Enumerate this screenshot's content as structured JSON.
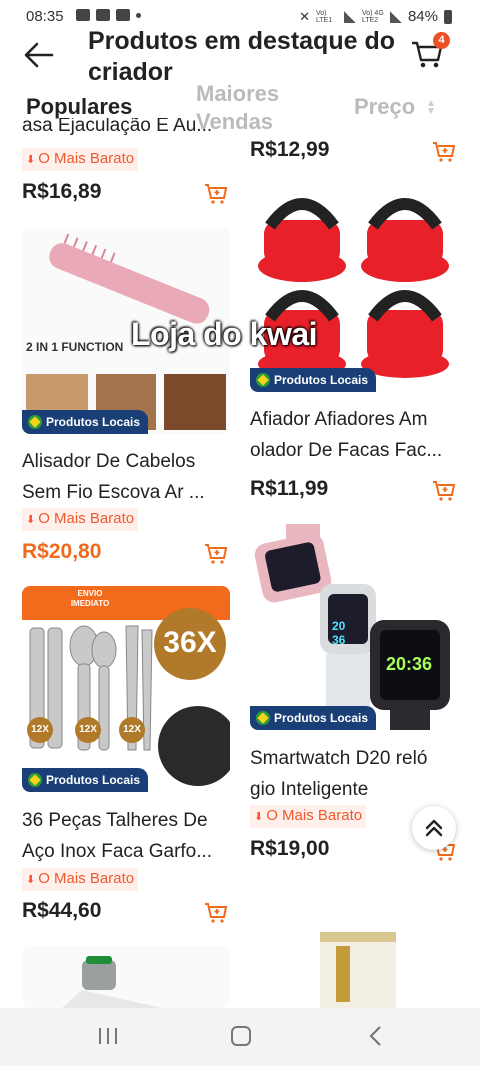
{
  "status_bar": {
    "time": "08:35",
    "battery": "84%",
    "net1": "Vo) LTE1",
    "net2": "Vo) 4G LTE2"
  },
  "header": {
    "title": "Produtos em destaque do criador",
    "cart_count": "4"
  },
  "tabs": {
    "popular": "Populares",
    "best_sellers": "Maiores Vendas",
    "price": "Preço"
  },
  "overlay": {
    "watermark": "Loja do kwai"
  },
  "labels": {
    "cheapest": "O Mais Barato",
    "local": "Produtos Locais"
  },
  "products": {
    "p0": {
      "name": "asa Ejaculação E Au...",
      "cheapest": true,
      "price": "R$16,89"
    },
    "p1": {
      "price": "R$12,99"
    },
    "p2": {
      "name1": "Alisador De Cabelos",
      "name2": "Sem Fio Escova Ar ...",
      "price": "R$20,80",
      "image_text": "2 IN 1 FUNCTION"
    },
    "p3": {
      "name1": "Afiador Afiadores Am",
      "name2": "olador De Facas Fac...",
      "price": "R$11,99"
    },
    "p4": {
      "name1": "36 Peças Talheres De",
      "name2": "Aço Inox Faca Garfo...",
      "price": "R$44,60",
      "image_text_big": "36X",
      "image_text_tag": "ENVIO IMEDIATO",
      "image_text_12": "12X"
    },
    "p5": {
      "name1": "Smartwatch D20 reló",
      "name2": "gio Inteligente",
      "price": "R$19,00",
      "image_text_time": "20:36"
    }
  },
  "colors": {
    "accent": "#f04e23",
    "price_orange": "#f06a1c",
    "local_badge": "#1a3f76"
  },
  "icons": [
    "back-arrow-icon",
    "cart-icon",
    "add-to-cart-icon",
    "scroll-to-top-icon",
    "recents-icon",
    "home-icon",
    "back-nav-icon"
  ]
}
